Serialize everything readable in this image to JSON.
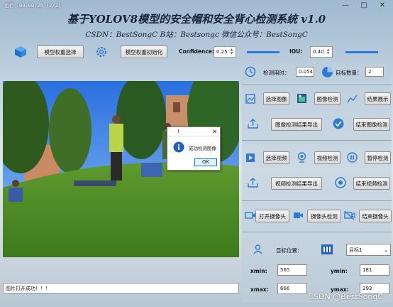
{
  "window": {
    "title": "运行：00:00:25 (2/2)",
    "minimize": "—",
    "maximize": "□",
    "close": "✕"
  },
  "header": {
    "title": "基于YOLOV8模型的安全帽和安全背心检测系统 v1.0",
    "subtitle": "CSDN：BestSongC   B站：Bestsongc   微信公众号：BestSongC"
  },
  "model": {
    "select_weights": "模型权重选择",
    "init_weights": "模型权重初始化",
    "confidence_label": "Confidence:",
    "confidence_value": "0.25",
    "confidence_level": 0.25,
    "iou_label": "IOU:",
    "iou_value": "0.40",
    "iou_level": 0.4
  },
  "stats": {
    "time_label": "检测用时：",
    "time_value": "0.054",
    "count_label": "目标数量：",
    "count_value": "2"
  },
  "image": {
    "select": "选择图像",
    "detect": "图像检测",
    "show_result": "结果展示",
    "export": "图像检测结果导出",
    "end": "结束图像检测"
  },
  "video": {
    "select": "选择视频",
    "detect": "视频检测",
    "pause": "暂停检测",
    "export": "视频检测结果导出",
    "end": "结束视频检测"
  },
  "camera": {
    "open": "打开摄像头",
    "detect": "摄像头检测",
    "end": "结束摄像头"
  },
  "target": {
    "position_label": "目标位置：",
    "select_value": "目标1",
    "xmin_label": "xmin:",
    "xmin_value": "565",
    "ymin_label": "ymin:",
    "ymin_value": "181",
    "xmax_label": "xmax:",
    "xmax_value": "666",
    "ymax_label": "ymax:",
    "ymax_value": "293"
  },
  "dialog": {
    "title": "!",
    "message": "成功检测图像",
    "ok": "OK",
    "close": "✕"
  },
  "status": {
    "text": "图片打开成功！！！"
  },
  "watermark": "CSDN @BestSongC",
  "colors": {
    "accent": "#2b7ad8",
    "title": "#15243a"
  }
}
